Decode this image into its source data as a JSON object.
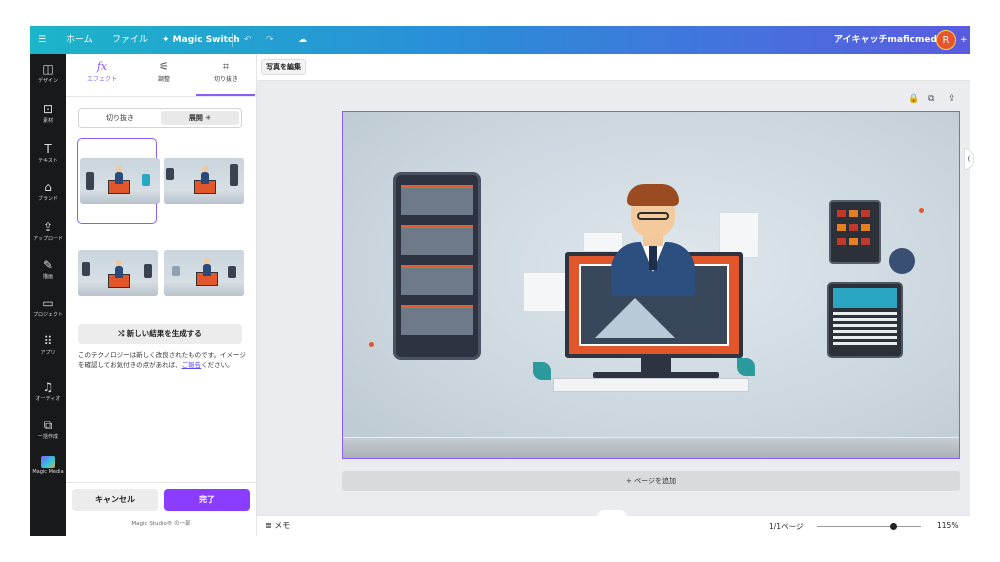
{
  "topbar": {
    "menu_icon": "hamburger-icon",
    "home": "ホーム",
    "file": "ファイル",
    "magic_switch": "✦ Magic Switch",
    "undo_icon": "undo-icon",
    "redo_icon": "redo-icon",
    "saved_icon": "cloud-check-icon",
    "design_title": "アイキャッチmaficmedia",
    "avatar_letter": "R",
    "add_icon": "plus-icon",
    "gradient_colors": [
      "#1cb5c9",
      "#5a5be0"
    ]
  },
  "rail": {
    "items": [
      {
        "label": "デザイン",
        "icon": "layout-icon"
      },
      {
        "label": "素材",
        "icon": "shapes-icon"
      },
      {
        "label": "テキスト",
        "icon": "text-icon"
      },
      {
        "label": "ブランド",
        "icon": "brand-icon"
      },
      {
        "label": "アップロード",
        "icon": "upload-icon"
      },
      {
        "label": "描画",
        "icon": "draw-icon"
      },
      {
        "label": "プロジェクト",
        "icon": "folder-icon"
      },
      {
        "label": "アプリ",
        "icon": "apps-icon"
      },
      {
        "label": "オーディオ",
        "icon": "audio-icon"
      },
      {
        "label": "一括作成",
        "icon": "bulk-create-icon"
      },
      {
        "label": "Magic Media",
        "icon": "magic-media-icon"
      }
    ]
  },
  "panel": {
    "tabs": [
      {
        "label": "エフェクト",
        "icon": "fx"
      },
      {
        "label": "調整",
        "icon": "⚟"
      },
      {
        "label": "切り抜き",
        "icon": "⌗"
      }
    ],
    "segments": {
      "crop": "切り抜き",
      "expand": "展開 ✳"
    },
    "generate_button": "⤭  新しい結果を生成する",
    "note_text": "このテクノロジーは新しく改良されたものです。イメージを確認してお気付きの点があれば、",
    "note_link": "ご報告",
    "note_tail": "ください。",
    "cancel": "キャンセル",
    "done": "完了",
    "magic_studio": "Magic Studio® の一部",
    "accent_color": "#8b3dff"
  },
  "workspace": {
    "edit_photo": "写真を編集",
    "page_tools": [
      "🔒",
      "⧉",
      "⇪"
    ],
    "add_page": "+ ページを追加",
    "memo": "≣ メモ",
    "pages": "1/1ページ",
    "zoom_percent": 115,
    "zoom": "115%"
  }
}
